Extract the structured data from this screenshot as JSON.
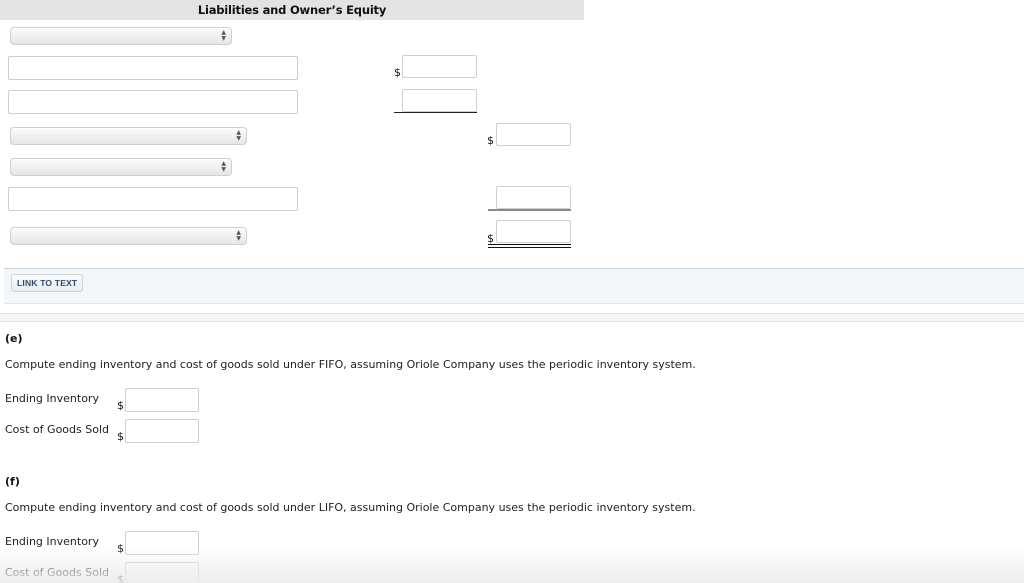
{
  "balance_sheet": {
    "header": "Liabilities and Owner’s Equity",
    "currency_symbol": "$",
    "rows": [
      {
        "type": "select",
        "value": ""
      },
      {
        "type": "text",
        "value": "",
        "amount": ""
      },
      {
        "type": "text",
        "value": "",
        "amount": ""
      },
      {
        "type": "select",
        "value": "",
        "total": ""
      },
      {
        "type": "select",
        "value": ""
      },
      {
        "type": "text",
        "value": "",
        "amount": ""
      },
      {
        "type": "select",
        "value": "",
        "total": ""
      }
    ]
  },
  "link_panel": {
    "button_label": "LINK TO TEXT"
  },
  "part_e": {
    "label": "(e)",
    "question": "Compute ending inventory and cost of goods sold under FIFO, assuming Oriole Company uses the periodic inventory system.",
    "fields": [
      {
        "label": "Ending Inventory",
        "currency": "$",
        "value": ""
      },
      {
        "label": "Cost of Goods Sold",
        "currency": "$",
        "value": ""
      }
    ]
  },
  "part_f": {
    "label": "(f)",
    "question": "Compute ending inventory and cost of goods sold under LIFO, assuming Oriole Company uses the periodic inventory system.",
    "fields": [
      {
        "label": "Ending Inventory",
        "currency": "$",
        "value": ""
      },
      {
        "label": "Cost of Goods Sold",
        "currency": "$",
        "value": ""
      }
    ]
  },
  "icons": {
    "select_arrows": "▲▼"
  }
}
